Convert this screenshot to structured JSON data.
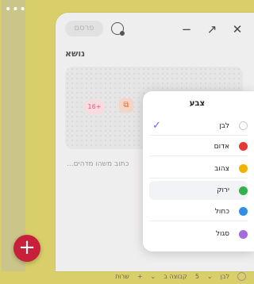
{
  "background": {
    "more_menu": "•••",
    "fab_label": "+"
  },
  "editor": {
    "publish_label": "פרסם",
    "title": "נושא",
    "age_badge": "16+",
    "image_badge": "⧉",
    "placeholder": "כתוב משהו מדהים...",
    "window": {
      "minimize": "−",
      "expand": "↗",
      "close": "✕"
    },
    "bottom_bar": {
      "color_value": "לבן",
      "color_dropdown": "⌄",
      "group_label": "קבוצה ב",
      "group_dropdown": "⌄",
      "number_value": "5",
      "add_label": "שרות",
      "add_icon": "+"
    }
  },
  "color_picker": {
    "title": "צבע",
    "options": [
      {
        "label": "לבן",
        "color": "#ffffff",
        "selected": true
      },
      {
        "label": "אדום",
        "color": "#e53935",
        "selected": false
      },
      {
        "label": "צהוב",
        "color": "#f2b300",
        "selected": false
      },
      {
        "label": "ירוק",
        "color": "#2fb34a",
        "selected": false
      },
      {
        "label": "כחול",
        "color": "#2f8ee6",
        "selected": false
      },
      {
        "label": "סגול",
        "color": "#a46be0",
        "selected": false
      }
    ],
    "check_mark": "✓"
  }
}
